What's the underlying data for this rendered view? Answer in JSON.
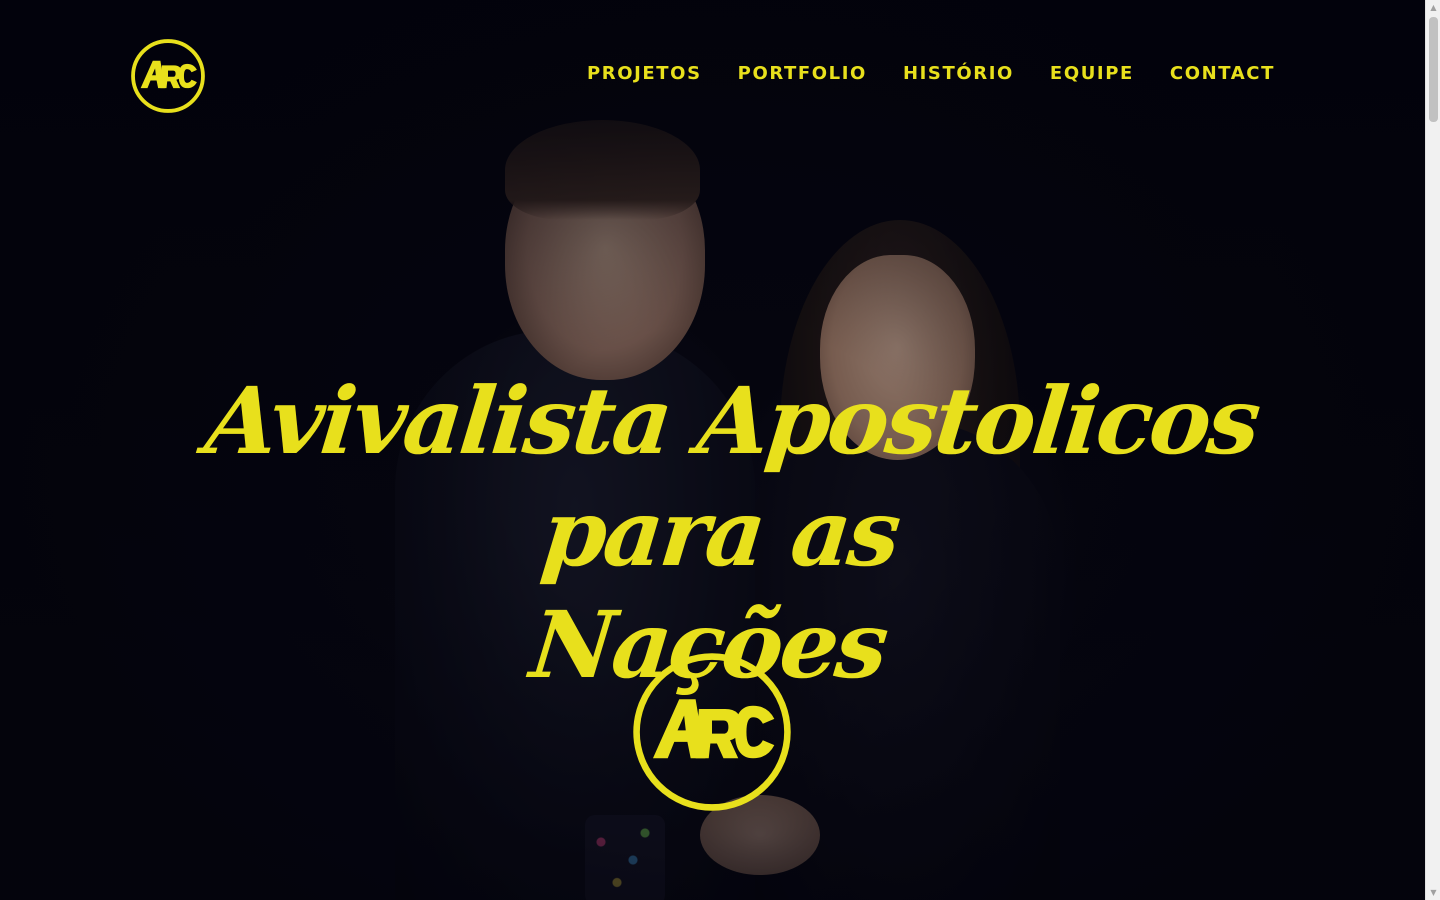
{
  "site": {
    "logo_text": "ARC",
    "brand_color": "#e8e01c",
    "background_color": "#05050d"
  },
  "nav": {
    "items": [
      {
        "label": "PROJETOS"
      },
      {
        "label": "PORTFOLIO"
      },
      {
        "label": "HISTÓRIO"
      },
      {
        "label": "EQUIPE"
      },
      {
        "label": "CONTACT"
      }
    ]
  },
  "hero": {
    "title_line1": "Avivalista Apostolicos para as",
    "title_line2": "Nações",
    "image": "couple-portrait",
    "emblem_text": "ARC"
  },
  "scrollbar": {
    "up_icon": "▲",
    "down_icon": "▼"
  }
}
